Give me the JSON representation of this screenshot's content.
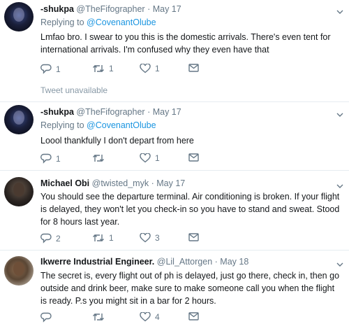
{
  "tweets": [
    {
      "name": "-shukpa",
      "handle": "@TheFifographer",
      "dot": "·",
      "date": "May 17",
      "replying_prefix": "Replying to",
      "replying_to": "@CovenantOlube",
      "text": "Lmfao bro. I swear to you this is the domestic arrivals. There's even tent for international arrivals. I'm confused why they even have that",
      "replies": "1",
      "retweets": "1",
      "likes": "1",
      "avatar": "dark-silhouette"
    },
    {
      "name": "-shukpa",
      "handle": "@TheFifographer",
      "dot": "·",
      "date": "May 17",
      "replying_prefix": "Replying to",
      "replying_to": "@CovenantOlube",
      "text": "Loool thankfully I don't depart from here",
      "replies": "1",
      "retweets": "",
      "likes": "1",
      "avatar": "dark-silhouette"
    },
    {
      "name": "Michael Obi",
      "handle": "@twisted_myk",
      "dot": "·",
      "date": "May 17",
      "text": "You should see the departure terminal. Air conditioning is broken. If your flight is delayed, they won't let you check-in so you have to stand and sweat. Stood for 8 hours last year.",
      "replies": "2",
      "retweets": "1",
      "likes": "3",
      "avatar": "photo"
    },
    {
      "name": "Ikwerre Industrial Engineer.",
      "handle": "@Lil_Attorgen",
      "dot": "·",
      "date": "May 18",
      "text": "The secret is, every flight out of ph is delayed, just go there, check in, then go outside and drink beer, make sure to make someone call you when the flight is ready. P.s you might sit in a bar for 2 hours.",
      "replies": "",
      "retweets": "",
      "likes": "4",
      "avatar": "photo"
    }
  ],
  "unavailable_text": "Tweet unavailable",
  "icons": [
    "reply-icon",
    "retweet-icon",
    "like-icon",
    "dm-icon",
    "chevron-down-icon"
  ],
  "colors": {
    "link": "#1b95e0",
    "muted": "#657786",
    "divider": "#e6ecf0"
  }
}
